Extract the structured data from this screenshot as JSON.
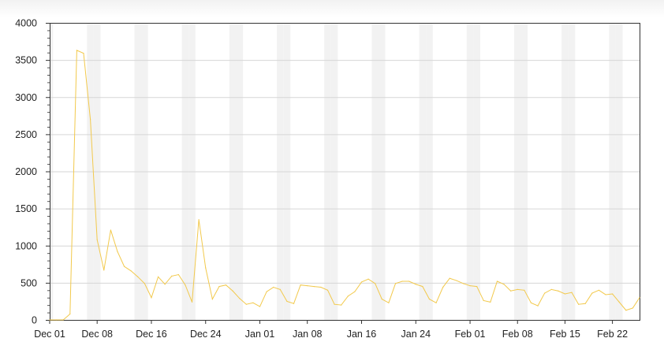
{
  "chart_data": {
    "type": "line",
    "title": "",
    "xlabel": "",
    "ylabel": "",
    "ylim": [
      0,
      4000
    ],
    "xlim": [
      "Dec 01",
      "Feb 24"
    ],
    "grid": true,
    "weekend_shading": true,
    "line_color": "#f2c94c",
    "y_ticks": [
      "0",
      "500",
      "1000",
      "1500",
      "2000",
      "2500",
      "3000",
      "3500",
      "4000"
    ],
    "x_ticks": [
      "Dec 01",
      "Dec 08",
      "Dec 16",
      "Dec 24",
      "Jan 01",
      "Jan 08",
      "Jan 16",
      "Jan 24",
      "Feb 01",
      "Feb 08",
      "Feb 15",
      "Feb 22"
    ],
    "series": [
      {
        "values": [
          0,
          0,
          0,
          80,
          3630,
          3590,
          2700,
          1080,
          670,
          1210,
          920,
          720,
          660,
          580,
          490,
          300,
          580,
          480,
          590,
          610,
          470,
          240,
          1350,
          700,
          280,
          450,
          470,
          390,
          290,
          210,
          230,
          180,
          380,
          440,
          410,
          250,
          220,
          470,
          460,
          450,
          440,
          400,
          210,
          200,
          320,
          380,
          510,
          550,
          490,
          280,
          230,
          490,
          520,
          520,
          480,
          450,
          280,
          230,
          440,
          560,
          530,
          490,
          460,
          450,
          260,
          240,
          520,
          480,
          390,
          410,
          400,
          230,
          190,
          360,
          410,
          390,
          350,
          370,
          210,
          220,
          360,
          400,
          340,
          350,
          240,
          130,
          160,
          300
        ]
      }
    ]
  }
}
